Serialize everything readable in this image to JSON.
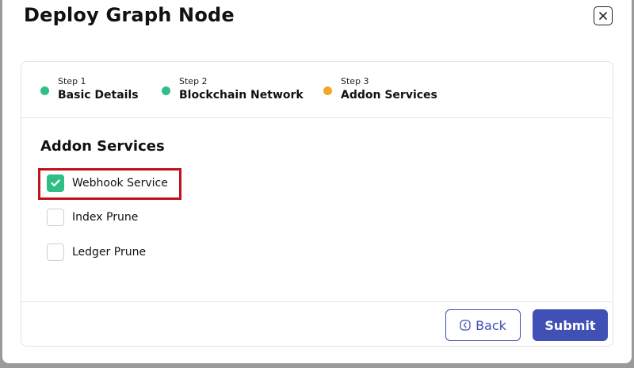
{
  "modal": {
    "title": "Deploy Graph Node"
  },
  "stepper": {
    "steps": [
      {
        "number": "Step 1",
        "label": "Basic Details",
        "status_color": "#2fbf86"
      },
      {
        "number": "Step 2",
        "label": "Blockchain Network",
        "status_color": "#2fbf86"
      },
      {
        "number": "Step 3",
        "label": "Addon Services",
        "status_color": "#f5a623"
      }
    ]
  },
  "section": {
    "title": "Addon Services",
    "options": [
      {
        "label": "Webhook Service",
        "checked": true
      },
      {
        "label": "Index Prune",
        "checked": false
      },
      {
        "label": "Ledger Prune",
        "checked": false
      }
    ]
  },
  "footer": {
    "back_label": "Back",
    "submit_label": "Submit"
  },
  "colors": {
    "primary": "#4150b5",
    "success": "#2fbf86",
    "pending": "#f5a623",
    "highlight": "#c0121b"
  },
  "icons": {
    "close": "close-icon",
    "back": "back-icon",
    "check": "check-icon"
  }
}
